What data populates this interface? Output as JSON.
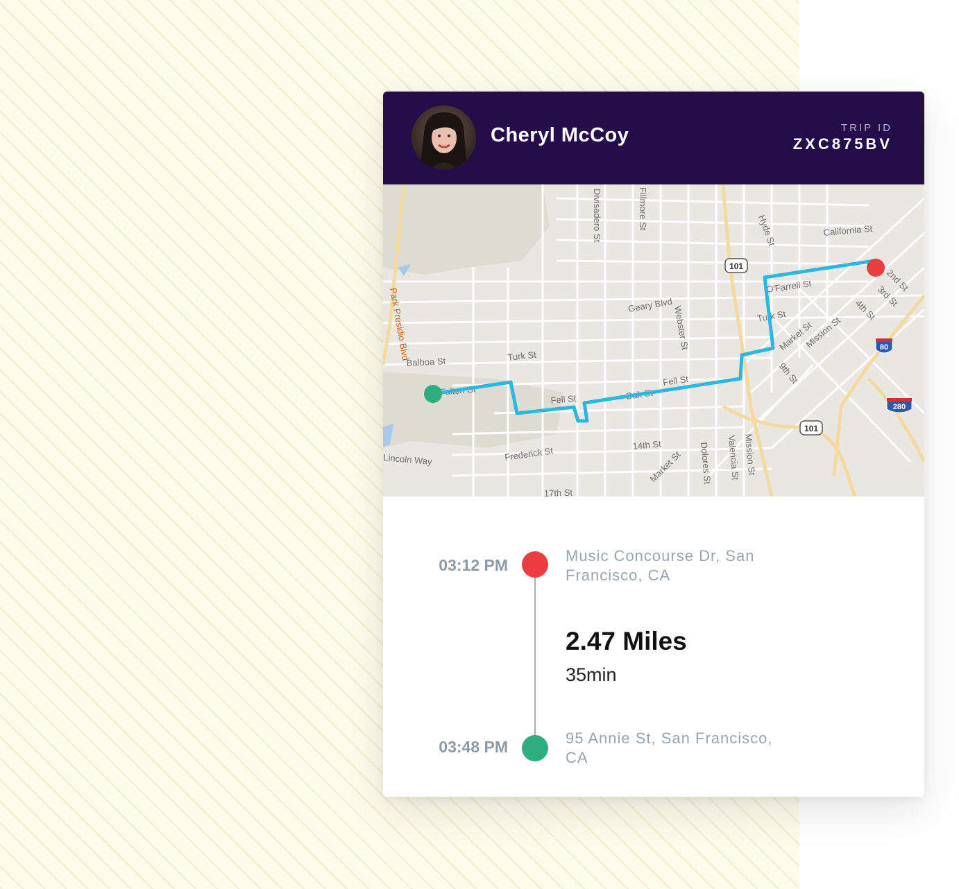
{
  "driver": {
    "name": "Cheryl McCoy"
  },
  "trip": {
    "id_label": "TRIP ID",
    "id": "ZXC875BV"
  },
  "map": {
    "streets": {
      "divisadero": "Divisadero St",
      "fillmore": "Fillmore St",
      "hyde": "Hyde St",
      "california": "California St",
      "ofarrell": "O'Farrell St",
      "second": "2nd St",
      "third": "3rd St",
      "fourth": "4th St",
      "geary": "Geary Blvd",
      "webster": "Webster St",
      "turk_east": "Turk St",
      "market_east": "Market St",
      "mission_east": "Mission St",
      "park_presidio": "Park Presidio Blvd",
      "balboa": "Balboa St",
      "turk_west": "Turk St",
      "fulton": "Fulton St",
      "fell_west": "Fell St",
      "oak": "Oak St",
      "fell_east": "Fell St",
      "ninth": "9th St",
      "lincoln": "Lincoln Way",
      "frederick": "Frederick St",
      "fourteenth": "14th St",
      "market_south": "Market St",
      "dolores": "Dolores St",
      "valencia": "Valencia St",
      "mission_south": "Mission St",
      "seventeenth": "17th St"
    },
    "shields": {
      "us101_north": "101",
      "us101_south": "101",
      "i80": "80",
      "i280": "280"
    },
    "colors": {
      "route": "#2eb6e3",
      "start_pin": "#ec3e40",
      "end_pin": "#2ead7f"
    }
  },
  "timeline": {
    "start": {
      "time": "03:12 PM",
      "address": "Music Concourse Dr, San Francisco, CA",
      "color": "#ec3e40"
    },
    "end": {
      "time": "03:48 PM",
      "address": "95 Annie St, San Francisco, CA",
      "color": "#2ead7f"
    },
    "distance": "2.47 Miles",
    "duration": "35min"
  }
}
